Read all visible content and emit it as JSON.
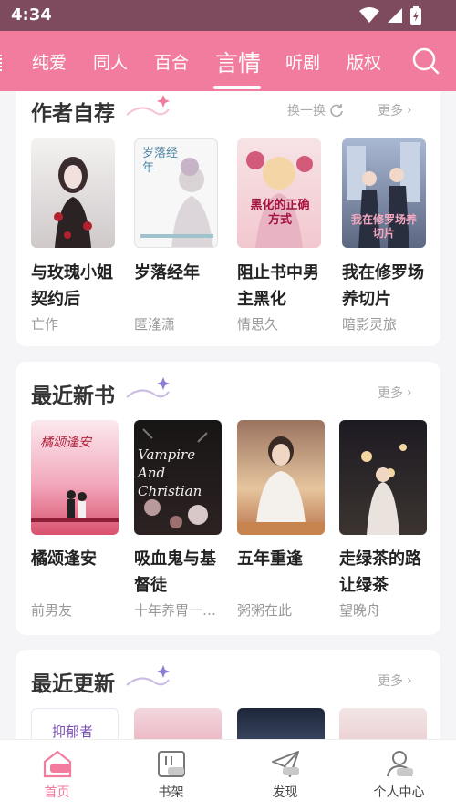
{
  "status_bar": {
    "time": "4:34"
  },
  "tabs": [
    {
      "label": "纯爱"
    },
    {
      "label": "同人"
    },
    {
      "label": "百合"
    },
    {
      "label": "言情",
      "active": true
    },
    {
      "label": "听剧"
    },
    {
      "label": "版权"
    }
  ],
  "colors": {
    "accent": "#f27c9e",
    "status_bar": "#7d4a5e"
  },
  "author_recommend": {
    "title": "作者自荐",
    "shuffle_label": "换一换",
    "more_label": "更多",
    "books": [
      {
        "title": "与玫瑰小姐契约后",
        "author": "亡作"
      },
      {
        "title": "岁落经年",
        "author": "匿湰潇",
        "cover_text": "岁落经年"
      },
      {
        "title": "阻止书中男主黑化",
        "author": "情思久",
        "cover_text": "黑化的正确方式"
      },
      {
        "title": "我在修罗场养切片",
        "author": "暗影灵旅",
        "cover_text": "我在修罗场养切片"
      }
    ]
  },
  "recent_new": {
    "title": "最近新书",
    "more_label": "更多",
    "books": [
      {
        "title": "橘颂逢安",
        "author": "前男友",
        "cover_text": "橘颂逢安"
      },
      {
        "title": "吸血鬼与基督徒",
        "author": "十年养胃一…",
        "cover_text": "Vampire And Christian"
      },
      {
        "title": "五年重逢",
        "author": "粥粥在此"
      },
      {
        "title": "走绿茶的路让绿茶",
        "author": "望晚舟"
      }
    ]
  },
  "recent_update": {
    "title": "最近更新",
    "more_label": "更多",
    "first_cover_text": "抑郁者"
  },
  "bottom_nav": [
    {
      "label": "首页",
      "icon": "home-icon",
      "active": true
    },
    {
      "label": "书架",
      "icon": "bookshelf-icon"
    },
    {
      "label": "发现",
      "icon": "discover-icon"
    },
    {
      "label": "个人中心",
      "icon": "profile-icon"
    }
  ]
}
